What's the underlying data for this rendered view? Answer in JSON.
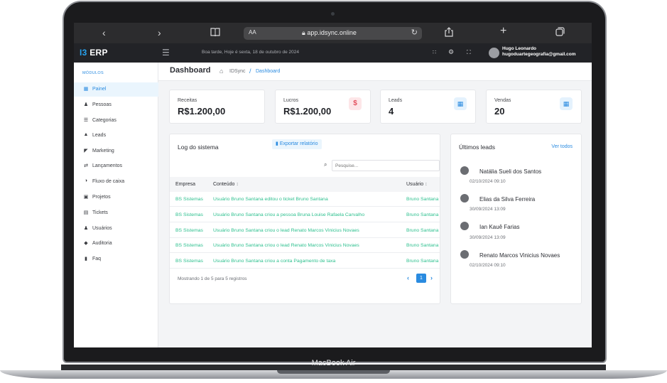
{
  "device": {
    "brand_label": "MacBook Air"
  },
  "browser": {
    "text_size_label": "AA",
    "url": "app.idsync.online",
    "icons": [
      "back-icon",
      "forward-icon",
      "book-icon",
      "lock-icon",
      "reload-icon",
      "share-icon",
      "plus-icon",
      "tabs-icon"
    ]
  },
  "topbar": {
    "brand_prefix": "I3",
    "brand_name": "ERP",
    "greeting": "Boa tarde, Hoje é sexta, 18 de outubro de 2024",
    "user_name": "Hugo Leonardo",
    "user_email": "hugoduartegeografia@gmail.com"
  },
  "sidebar": {
    "section_label": "MÓDULOS",
    "items": [
      {
        "label": "Painel",
        "icon": "dashboard-icon",
        "active": true
      },
      {
        "label": "Pessoas",
        "icon": "people-icon"
      },
      {
        "label": "Categorias",
        "icon": "list-icon"
      },
      {
        "label": "Leads",
        "icon": "user-icon"
      },
      {
        "label": "Marketing",
        "icon": "megaphone-icon"
      },
      {
        "label": "Lançamentos",
        "icon": "transfer-icon"
      },
      {
        "label": "Fluxo de caixa",
        "icon": "cash-flow-icon"
      },
      {
        "label": "Projetos",
        "icon": "briefcase-icon"
      },
      {
        "label": "Tickets",
        "icon": "ticket-icon"
      },
      {
        "label": "Usuários",
        "icon": "users-icon"
      },
      {
        "label": "Auditoria",
        "icon": "shield-icon"
      },
      {
        "label": "Faq",
        "icon": "faq-icon"
      }
    ]
  },
  "breadcrumb": {
    "page_title": "Dashboard",
    "root": "IDSync",
    "separator": "/",
    "current": "Dashboard"
  },
  "stats": [
    {
      "label": "Receitas",
      "value": "R$1.200,00"
    },
    {
      "label": "Lucros",
      "value": "R$1.200,00",
      "badge": "$"
    },
    {
      "label": "Leads",
      "value": "4",
      "badge_icon": "calendar-icon"
    },
    {
      "label": "Vendas",
      "value": "20",
      "badge_icon": "calendar-icon"
    }
  ],
  "log": {
    "title": "Log do sistema",
    "export_label": "Exportar relatório",
    "search_placeholder": "Pesquise...",
    "columns": [
      "Empresa",
      "Conteúdo",
      "Usuário"
    ],
    "rows": [
      [
        "BS Sistemas",
        "Usuário Bruno Santana editou o ticket Bruno Santana",
        "Bruno Santana"
      ],
      [
        "BS Sistemas",
        "Usuário Bruno Santana criou a pessoa Bruna Louise Rafaela Carvalho",
        "Bruno Santana"
      ],
      [
        "BS Sistemas",
        "Usuário Bruno Santana criou o lead Renato Marcos Vinicius Novaes",
        "Bruno Santana"
      ],
      [
        "BS Sistemas",
        "Usuário Bruno Santana criou o lead Renato Marcos Vinicius Novaes",
        "Bruno Santana"
      ],
      [
        "BS Sistemas",
        "Usuário Bruno Santana criou a conta Pagamento de taxa",
        "Bruno Santana"
      ]
    ],
    "footer": "Mostrando 1 de 5 para 5 registros",
    "current_page": "1"
  },
  "leads": {
    "title": "Últimos leads",
    "view_all": "Ver todos",
    "items": [
      {
        "name": "Natália Sueli dos Santos",
        "date": "02/10/2024 09:10"
      },
      {
        "name": "Elias da Silva Ferreira",
        "date": "30/09/2024 13:09"
      },
      {
        "name": "Ian Kauê Farias",
        "date": "30/09/2024 13:09"
      },
      {
        "name": "Renato Marcos Vinicius Novaes",
        "date": "02/10/2024 09:10"
      }
    ]
  }
}
